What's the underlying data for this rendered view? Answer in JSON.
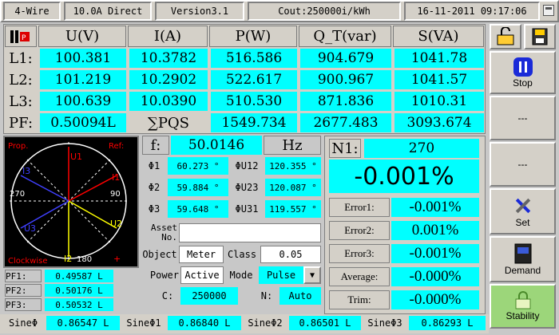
{
  "header": {
    "mode": "4-Wire",
    "range": "10.0A Direct",
    "version": "Version3.1",
    "constant": "Cout:250000i/kWh",
    "datetime": "16-11-2011 09:17:06"
  },
  "table": {
    "columns": [
      "U(V)",
      "I(A)",
      "P(W)",
      "Q_T(var)",
      "S(VA)"
    ],
    "rows": [
      {
        "label": "L1:",
        "u": "100.381",
        "i": "10.3782",
        "p": "516.586",
        "q": "904.679",
        "s": "1041.78"
      },
      {
        "label": "L2:",
        "u": "101.219",
        "i": "10.2902",
        "p": "522.617",
        "q": "900.967",
        "s": "1041.57"
      },
      {
        "label": "L3:",
        "u": "100.639",
        "i": "10.0390",
        "p": "510.530",
        "q": "871.836",
        "s": "1010.31"
      }
    ],
    "pf_label": "PF:",
    "pf_value": "0.50094L",
    "sum_label": "∑PQS",
    "sum_p": "1549.734",
    "sum_q": "2677.483",
    "sum_s": "3093.674"
  },
  "phasor": {
    "prop_label": "Prop.",
    "ref_label": "Ref:",
    "clockwise_label": "Clockwise",
    "plus": "+",
    "angle_270": "270",
    "angle_90": "90",
    "angle_180": "180",
    "labels": {
      "u1": "U1",
      "i1": "I1",
      "u2": "U2",
      "i2": "I2",
      "u3": "U3",
      "i3": "I3"
    }
  },
  "pf_phases": [
    {
      "label": "PF1:",
      "value": "0.49587 L"
    },
    {
      "label": "PF2:",
      "value": "0.50176 L"
    },
    {
      "label": "PF3:",
      "value": "0.50532 L"
    }
  ],
  "freq": {
    "label": "f:",
    "value": "50.0146",
    "unit": "Hz"
  },
  "angles": [
    {
      "label": "Φ1",
      "value": "60.273 °",
      "label2": "ΦU12",
      "value2": "120.355 °"
    },
    {
      "label": "Φ2",
      "value": "59.884 °",
      "label2": "ΦU23",
      "value2": "120.087 °"
    },
    {
      "label": "Φ3",
      "value": "59.648 °",
      "label2": "ΦU31",
      "value2": "119.557 °"
    }
  ],
  "form": {
    "asset_label": "Asset\nNo.",
    "asset_value": "",
    "object_label": "Object",
    "object_value": "Meter",
    "class_label": "Class",
    "class_value": "0.05",
    "power_label": "Power",
    "power_value": "Active",
    "mode_label": "Mode",
    "mode_value": "Pulse",
    "c_label": "C:",
    "c_value": "250000",
    "n_label": "N:",
    "n_value": "Auto"
  },
  "error_panel": {
    "n1_label": "N1:",
    "n1_value": "270",
    "big_error": "-0.001%",
    "rows": [
      {
        "label": "Error1:",
        "value": "-0.001%"
      },
      {
        "label": "Error2:",
        "value": "0.001%"
      },
      {
        "label": "Error3:",
        "value": "-0.001%"
      },
      {
        "label": "Average:",
        "value": "-0.000%"
      },
      {
        "label": "Trim:",
        "value": "-0.000%"
      }
    ]
  },
  "sidebar": {
    "stop_label": "Stop",
    "empty1": "---",
    "empty2": "---",
    "set_label": "Set",
    "demand_label": "Demand",
    "stability_label": "Stability"
  },
  "footer": [
    {
      "label": "SineΦ",
      "value": "0.86547 L"
    },
    {
      "label": "SineΦ1",
      "value": "0.86840 L"
    },
    {
      "label": "SineΦ2",
      "value": "0.86501 L"
    },
    {
      "label": "SineΦ3",
      "value": "0.86293 L"
    }
  ],
  "colors": {
    "cyan": "#00ffff",
    "phase1": "#ff0000",
    "phase2": "#ffff00",
    "phase3": "#4040ff",
    "stop_icon": "#1a2ad8",
    "stability_bg": "#9cd67a"
  }
}
